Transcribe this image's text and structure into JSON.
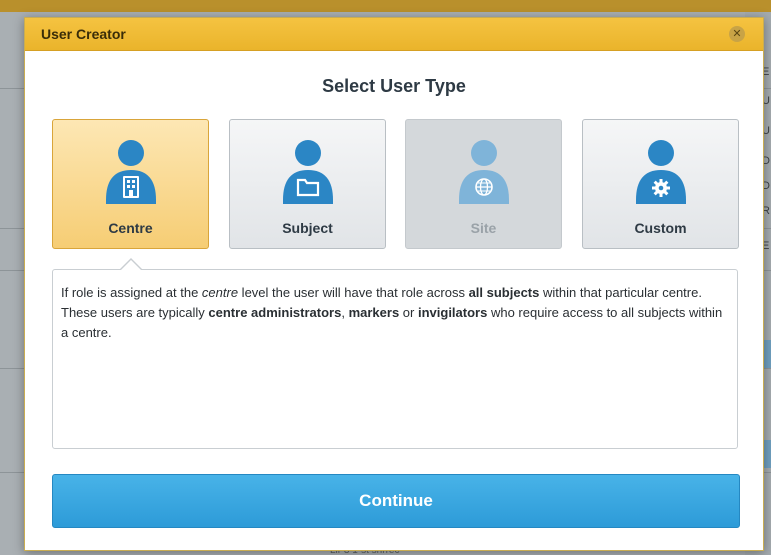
{
  "background": {
    "side_letters": [
      "E",
      "U",
      "U",
      "D",
      "D",
      "R",
      "E"
    ],
    "footer_text": "Lir 3 1-st snrrec"
  },
  "dialog": {
    "title": "User Creator",
    "close_icon": "close-icon",
    "section_title": "Select User Type",
    "user_types": [
      {
        "label": "Centre",
        "icon": "user-building-icon",
        "state": "selected"
      },
      {
        "label": "Subject",
        "icon": "user-folder-icon",
        "state": "normal"
      },
      {
        "label": "Site",
        "icon": "user-globe-icon",
        "state": "disabled"
      },
      {
        "label": "Custom",
        "icon": "user-gear-icon",
        "state": "normal"
      }
    ],
    "description": {
      "parts": [
        {
          "text": "If role is assigned at the ",
          "style": "normal"
        },
        {
          "text": "centre",
          "style": "italic"
        },
        {
          "text": " level the user will have that role across ",
          "style": "normal"
        },
        {
          "text": "all subjects",
          "style": "bold"
        },
        {
          "text": " within that particular centre. These users are typically ",
          "style": "normal"
        },
        {
          "text": "centre administrators",
          "style": "bold"
        },
        {
          "text": ", ",
          "style": "normal"
        },
        {
          "text": "markers",
          "style": "bold"
        },
        {
          "text": " or ",
          "style": "normal"
        },
        {
          "text": "invigilators",
          "style": "bold"
        },
        {
          "text": " who require access to all subjects within a centre.",
          "style": "normal"
        }
      ]
    },
    "continue_label": "Continue"
  },
  "colors": {
    "header": "#eab42b",
    "selected_card": "#f6cd74",
    "icon_blue": "#2b86c5",
    "icon_blue_disabled": "#7fb4d9",
    "continue_button": "#2d9bd8"
  }
}
